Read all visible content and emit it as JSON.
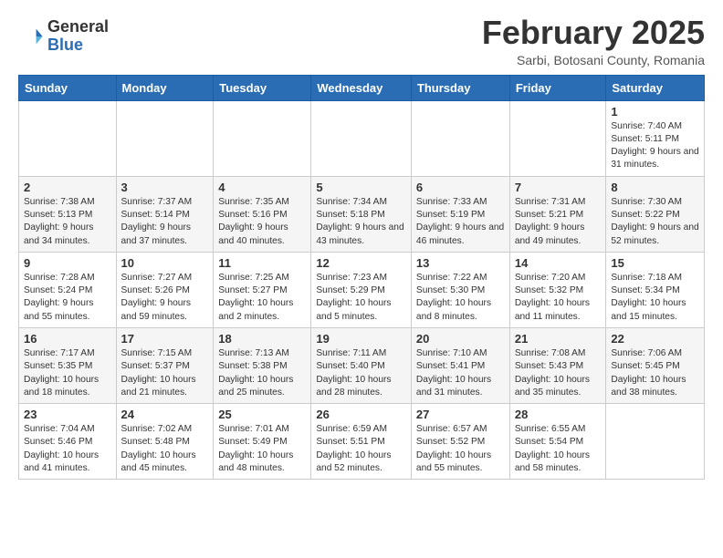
{
  "header": {
    "logo_general": "General",
    "logo_blue": "Blue",
    "month_title": "February 2025",
    "location": "Sarbi, Botosani County, Romania"
  },
  "weekdays": [
    "Sunday",
    "Monday",
    "Tuesday",
    "Wednesday",
    "Thursday",
    "Friday",
    "Saturday"
  ],
  "weeks": [
    [
      {
        "day": "",
        "info": ""
      },
      {
        "day": "",
        "info": ""
      },
      {
        "day": "",
        "info": ""
      },
      {
        "day": "",
        "info": ""
      },
      {
        "day": "",
        "info": ""
      },
      {
        "day": "",
        "info": ""
      },
      {
        "day": "1",
        "info": "Sunrise: 7:40 AM\nSunset: 5:11 PM\nDaylight: 9 hours and 31 minutes."
      }
    ],
    [
      {
        "day": "2",
        "info": "Sunrise: 7:38 AM\nSunset: 5:13 PM\nDaylight: 9 hours and 34 minutes."
      },
      {
        "day": "3",
        "info": "Sunrise: 7:37 AM\nSunset: 5:14 PM\nDaylight: 9 hours and 37 minutes."
      },
      {
        "day": "4",
        "info": "Sunrise: 7:35 AM\nSunset: 5:16 PM\nDaylight: 9 hours and 40 minutes."
      },
      {
        "day": "5",
        "info": "Sunrise: 7:34 AM\nSunset: 5:18 PM\nDaylight: 9 hours and 43 minutes."
      },
      {
        "day": "6",
        "info": "Sunrise: 7:33 AM\nSunset: 5:19 PM\nDaylight: 9 hours and 46 minutes."
      },
      {
        "day": "7",
        "info": "Sunrise: 7:31 AM\nSunset: 5:21 PM\nDaylight: 9 hours and 49 minutes."
      },
      {
        "day": "8",
        "info": "Sunrise: 7:30 AM\nSunset: 5:22 PM\nDaylight: 9 hours and 52 minutes."
      }
    ],
    [
      {
        "day": "9",
        "info": "Sunrise: 7:28 AM\nSunset: 5:24 PM\nDaylight: 9 hours and 55 minutes."
      },
      {
        "day": "10",
        "info": "Sunrise: 7:27 AM\nSunset: 5:26 PM\nDaylight: 9 hours and 59 minutes."
      },
      {
        "day": "11",
        "info": "Sunrise: 7:25 AM\nSunset: 5:27 PM\nDaylight: 10 hours and 2 minutes."
      },
      {
        "day": "12",
        "info": "Sunrise: 7:23 AM\nSunset: 5:29 PM\nDaylight: 10 hours and 5 minutes."
      },
      {
        "day": "13",
        "info": "Sunrise: 7:22 AM\nSunset: 5:30 PM\nDaylight: 10 hours and 8 minutes."
      },
      {
        "day": "14",
        "info": "Sunrise: 7:20 AM\nSunset: 5:32 PM\nDaylight: 10 hours and 11 minutes."
      },
      {
        "day": "15",
        "info": "Sunrise: 7:18 AM\nSunset: 5:34 PM\nDaylight: 10 hours and 15 minutes."
      }
    ],
    [
      {
        "day": "16",
        "info": "Sunrise: 7:17 AM\nSunset: 5:35 PM\nDaylight: 10 hours and 18 minutes."
      },
      {
        "day": "17",
        "info": "Sunrise: 7:15 AM\nSunset: 5:37 PM\nDaylight: 10 hours and 21 minutes."
      },
      {
        "day": "18",
        "info": "Sunrise: 7:13 AM\nSunset: 5:38 PM\nDaylight: 10 hours and 25 minutes."
      },
      {
        "day": "19",
        "info": "Sunrise: 7:11 AM\nSunset: 5:40 PM\nDaylight: 10 hours and 28 minutes."
      },
      {
        "day": "20",
        "info": "Sunrise: 7:10 AM\nSunset: 5:41 PM\nDaylight: 10 hours and 31 minutes."
      },
      {
        "day": "21",
        "info": "Sunrise: 7:08 AM\nSunset: 5:43 PM\nDaylight: 10 hours and 35 minutes."
      },
      {
        "day": "22",
        "info": "Sunrise: 7:06 AM\nSunset: 5:45 PM\nDaylight: 10 hours and 38 minutes."
      }
    ],
    [
      {
        "day": "23",
        "info": "Sunrise: 7:04 AM\nSunset: 5:46 PM\nDaylight: 10 hours and 41 minutes."
      },
      {
        "day": "24",
        "info": "Sunrise: 7:02 AM\nSunset: 5:48 PM\nDaylight: 10 hours and 45 minutes."
      },
      {
        "day": "25",
        "info": "Sunrise: 7:01 AM\nSunset: 5:49 PM\nDaylight: 10 hours and 48 minutes."
      },
      {
        "day": "26",
        "info": "Sunrise: 6:59 AM\nSunset: 5:51 PM\nDaylight: 10 hours and 52 minutes."
      },
      {
        "day": "27",
        "info": "Sunrise: 6:57 AM\nSunset: 5:52 PM\nDaylight: 10 hours and 55 minutes."
      },
      {
        "day": "28",
        "info": "Sunrise: 6:55 AM\nSunset: 5:54 PM\nDaylight: 10 hours and 58 minutes."
      },
      {
        "day": "",
        "info": ""
      }
    ]
  ]
}
